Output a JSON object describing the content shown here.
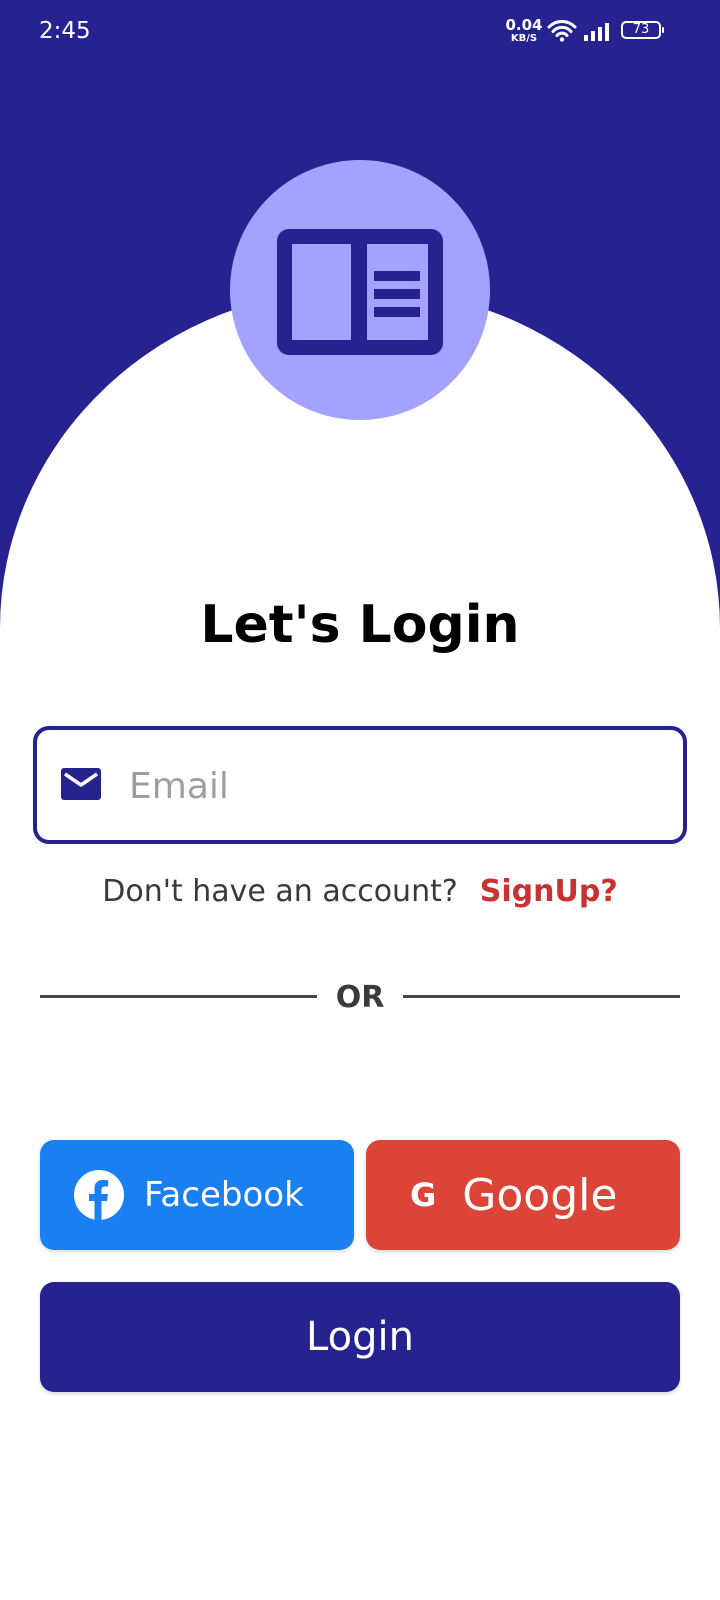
{
  "status_bar": {
    "time": "2:45",
    "net_speed_value": "0.04",
    "net_speed_unit": "KB/S",
    "battery": "73",
    "icons": [
      "wifi-icon",
      "signal-icon",
      "battery-icon"
    ]
  },
  "logo": {
    "icon": "book-open-icon",
    "circle_color": "#a3a3ff"
  },
  "title": "Let's Login",
  "email": {
    "placeholder": "Email",
    "value": "",
    "icon": "mail-icon"
  },
  "signup": {
    "prompt": "Don't have an account?",
    "link": "SignUp?"
  },
  "divider_text": "OR",
  "social": {
    "facebook_label": "Facebook",
    "google_label": "Google",
    "google_icon_glyph": "G"
  },
  "login_label": "Login",
  "colors": {
    "primary": "#262391",
    "facebook": "#1a7ff0",
    "google": "#db4437",
    "signup_link": "#c83232"
  }
}
